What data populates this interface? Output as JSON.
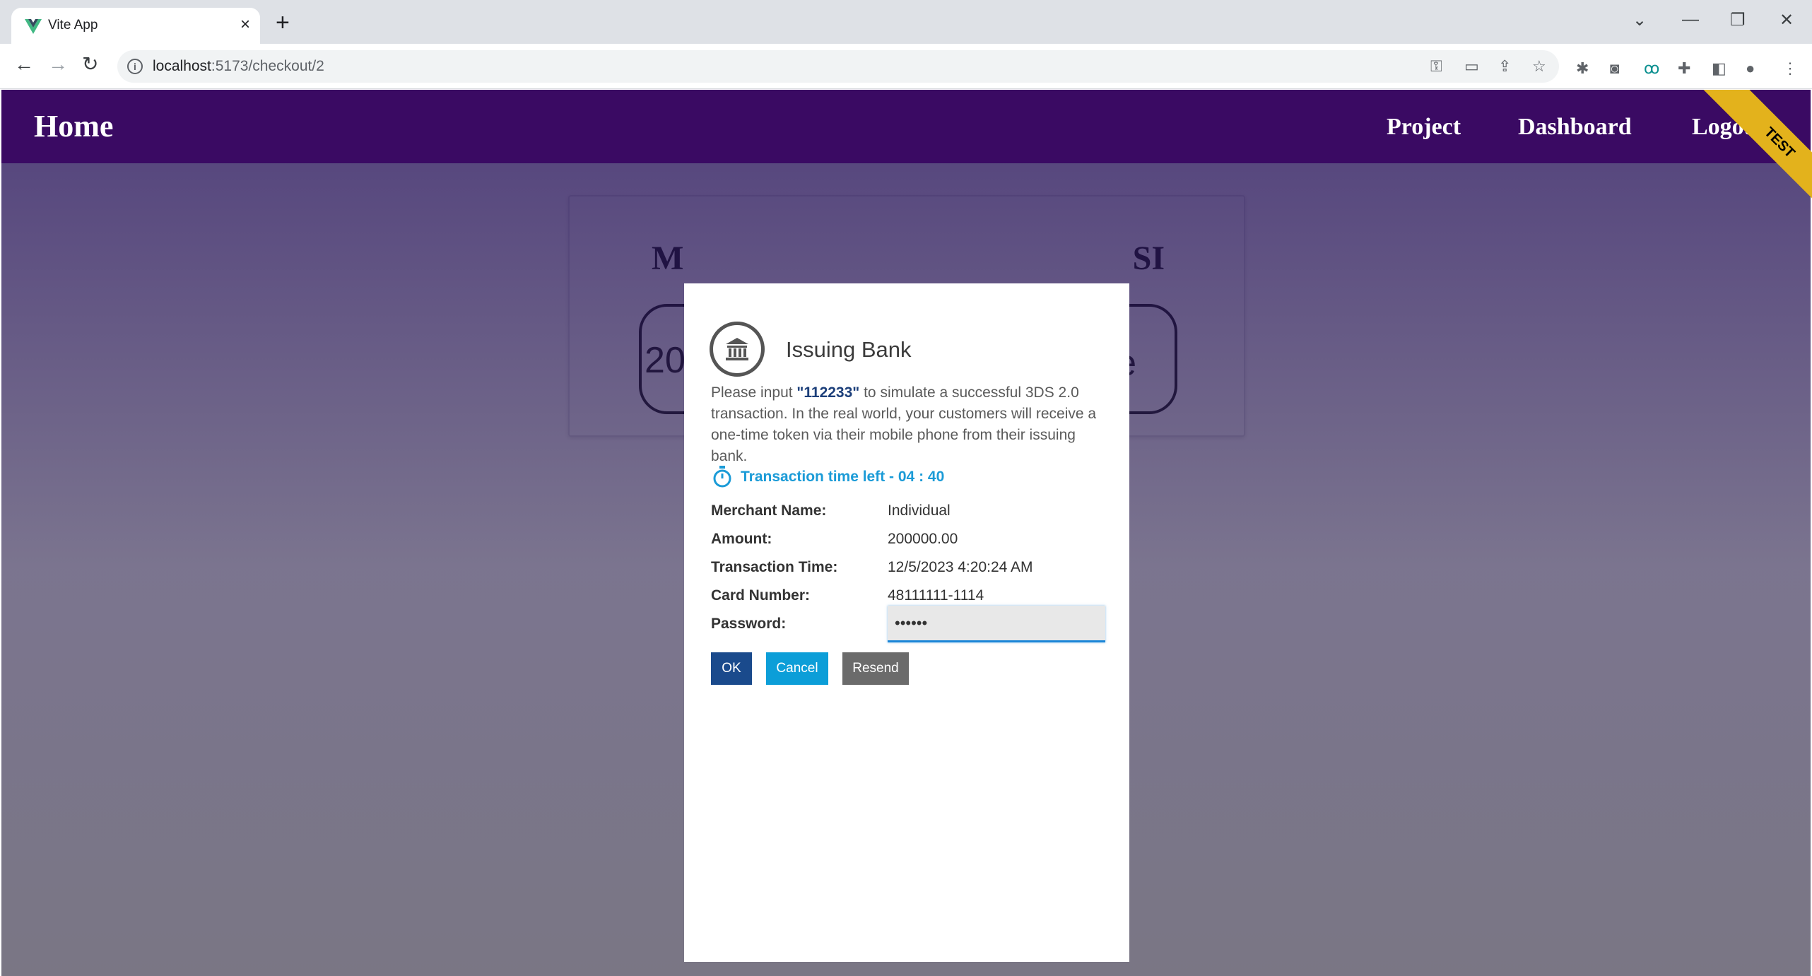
{
  "browser": {
    "tab_title": "Vite App",
    "tab_close": "×",
    "new_tab": "+",
    "url_host": "localhost",
    "url_path": ":5173/checkout/2",
    "win_min": "—",
    "win_restore": "❐",
    "win_close": "✕",
    "win_dropdown": "⌄"
  },
  "navbar": {
    "home": "Home",
    "links": [
      "Project",
      "Dashboard",
      "Logout"
    ],
    "ribbon": "TEST"
  },
  "background_card": {
    "title_left": "M",
    "title_right": "SI",
    "amount_left": "200",
    "amount_right": "e"
  },
  "modal": {
    "title": "Issuing Bank",
    "instr_before": "Please input ",
    "instr_code": "\"112233\"",
    "instr_after": " to simulate a successful 3DS 2.0 transaction. In the real world, your customers will receive a one-time token via their mobile phone from their issuing bank.",
    "timer_label": "Transaction time left -  04 : 40",
    "rows": [
      {
        "label": "Merchant Name:",
        "value": "Individual"
      },
      {
        "label": "Amount:",
        "value": "200000.00"
      },
      {
        "label": "Transaction Time:",
        "value": "12/5/2023 4:20:24 AM"
      },
      {
        "label": "Card Number:",
        "value": "48111111-1114"
      }
    ],
    "password_label": "Password:",
    "password_value": "••••••",
    "buttons": {
      "ok": "OK",
      "cancel": "Cancel",
      "resend": "Resend"
    }
  },
  "colors": {
    "navbar": "#3a0a63",
    "ok_button": "#1a4a8c",
    "cancel_button": "#0c9ed8",
    "resend_button": "#6b6b6b",
    "timer": "#1b9bd7",
    "ribbon": "#e3b21c"
  }
}
